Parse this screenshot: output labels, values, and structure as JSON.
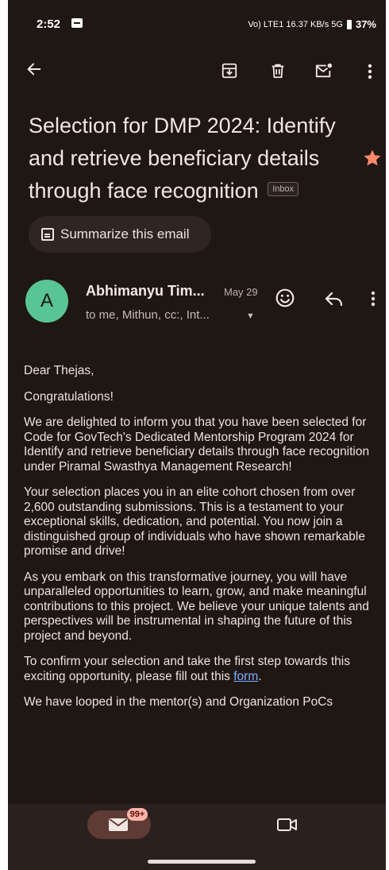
{
  "status_bar": {
    "time": "2:52",
    "network_icons": "Vo) LTE1 16.37 KB/s 5G",
    "battery": "37%"
  },
  "app_bar": {
    "back": "arrow-left-icon",
    "actions": [
      "archive-icon",
      "trash-icon",
      "mark-unread-icon",
      "more-vert-icon"
    ]
  },
  "email": {
    "subject": "Selection for DMP 2024: Identify and retrieve beneficiary details through face recognition",
    "label_chip": "Inbox",
    "starred": true,
    "summarize_label": "Summarize this email",
    "sender": {
      "avatar_letter": "A",
      "avatar_color": "#5ac594",
      "name": "Abhimanyu Tim...",
      "date": "May 29",
      "recipients": "to me, Mithun, cc:, Int..."
    },
    "body": {
      "greeting": "Dear Thejas,",
      "p1": "Congratulations!",
      "p2": "We are delighted to inform you that you have been selected for Code for GovTech's Dedicated Mentorship Program 2024 for Identify and retrieve beneficiary details through face recognition under Piramal Swasthya Management Research!",
      "p3": "Your selection places you in an elite cohort chosen from over 2,600 outstanding submissions. This is a testament to your exceptional skills, dedication, and potential. You now join a distinguished group of individuals who have shown remarkable promise and drive!",
      "p4": "As you embark on this transformative journey, you will have unparalleled opportunities to learn, grow, and make meaningful contributions to this project. We believe your unique talents and perspectives will be instrumental in shaping the future of this project and beyond.",
      "p5_prefix": "To confirm your selection and take the first step towards this exciting opportunity, please fill out this ",
      "p5_link": "form",
      "p5_suffix": ".",
      "p6": "We have looped in the mentor(s) and Organization PoCs"
    }
  },
  "bottom_nav": {
    "mail_badge": "99+",
    "items": [
      "mail-icon",
      "meet-video-icon"
    ]
  },
  "colors": {
    "background": "#1f1714",
    "star": "#ff8a6b",
    "link": "#7fb0ff",
    "badge": "#ffb4a9"
  }
}
